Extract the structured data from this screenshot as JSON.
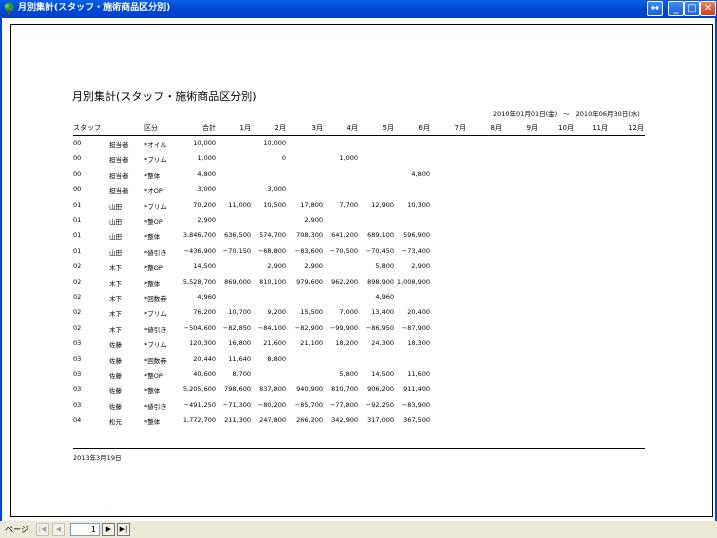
{
  "window": {
    "title": "月別集計(スタッフ・施術商品区分別)",
    "colors": {
      "titlebar": "#0046D5",
      "close": "#C8431C"
    }
  },
  "report": {
    "title": "月別集計(スタッフ・施術商品区分別)",
    "date_from": "2010年01月01日(金)",
    "date_sep": "〜",
    "date_to": "2010年06月30日(水)",
    "headers": [
      "スタッフ",
      "区分",
      "合計",
      "1月",
      "2月",
      "3月",
      "4月",
      "5月",
      "6月",
      "7月",
      "8月",
      "9月",
      "10月",
      "11月",
      "12月"
    ],
    "rows": [
      [
        "00",
        "担当者",
        "*オイル",
        "10,000",
        "",
        "10,000",
        "",
        "",
        "",
        ""
      ],
      [
        "00",
        "担当者",
        "*ブリム",
        "1,000",
        "",
        "0",
        "",
        "1,000",
        "",
        ""
      ],
      [
        "00",
        "担当者",
        "*整体",
        "4,800",
        "",
        "",
        "",
        "",
        "",
        "4,800"
      ],
      [
        "00",
        "担当者",
        "*オOP",
        "3,000",
        "",
        "3,000",
        "",
        "",
        "",
        ""
      ],
      [
        "01",
        "山田",
        "*ブリム",
        "70,200",
        "11,000",
        "10,500",
        "17,800",
        "7,700",
        "12,900",
        "10,300"
      ],
      [
        "01",
        "山田",
        "*整OP",
        "2,900",
        "",
        "",
        "2,900",
        "",
        "",
        ""
      ],
      [
        "01",
        "山田",
        "*整体",
        "3,846,700",
        "636,500",
        "574,700",
        "708,300",
        "641,200",
        "689,100",
        "596,900"
      ],
      [
        "01",
        "山田",
        "*値引き",
        "−436,900",
        "−70,150",
        "−68,800",
        "−83,600",
        "−70,500",
        "−70,450",
        "−73,400"
      ],
      [
        "02",
        "木下",
        "*整OP",
        "14,500",
        "",
        "2,900",
        "2,900",
        "",
        "5,800",
        "2,900"
      ],
      [
        "02",
        "木下",
        "*整体",
        "5,528,700",
        "869,000",
        "810,100",
        "979,600",
        "962,200",
        "898,900",
        "1,008,900"
      ],
      [
        "02",
        "木下",
        "*回数券",
        "4,960",
        "",
        "",
        "",
        "",
        "4,960",
        ""
      ],
      [
        "02",
        "木下",
        "*ブリム",
        "76,200",
        "10,700",
        "9,200",
        "15,500",
        "7,000",
        "13,400",
        "20,400"
      ],
      [
        "02",
        "木下",
        "*値引き",
        "−504,600",
        "−82,850",
        "−84,100",
        "−82,900",
        "−99,900",
        "−86,950",
        "−87,900"
      ],
      [
        "03",
        "佐藤",
        "*ブリム",
        "120,300",
        "16,800",
        "21,600",
        "21,100",
        "18,200",
        "24,300",
        "18,300"
      ],
      [
        "03",
        "佐藤",
        "*回数券",
        "20,440",
        "11,640",
        "8,800",
        "",
        "",
        "",
        ""
      ],
      [
        "03",
        "佐藤",
        "*整OP",
        "40,600",
        "8,700",
        "",
        "",
        "5,800",
        "14,500",
        "11,600"
      ],
      [
        "03",
        "佐藤",
        "*整体",
        "5,205,600",
        "798,600",
        "837,800",
        "940,900",
        "810,700",
        "906,200",
        "911,400"
      ],
      [
        "03",
        "佐藤",
        "*値引き",
        "−491,250",
        "−71,300",
        "−80,200",
        "−85,700",
        "−77,800",
        "−92,250",
        "−83,900"
      ],
      [
        "04",
        "松元",
        "*整体",
        "1,772,700",
        "211,300",
        "247,800",
        "266,200",
        "342,900",
        "317,000",
        "367,500"
      ]
    ],
    "print_date": "2013年3月19日"
  },
  "statusbar": {
    "page_label": "ページ",
    "page_value": "1",
    "first": "|◀",
    "prev": "◀",
    "next": "▶",
    "last": "▶|"
  }
}
